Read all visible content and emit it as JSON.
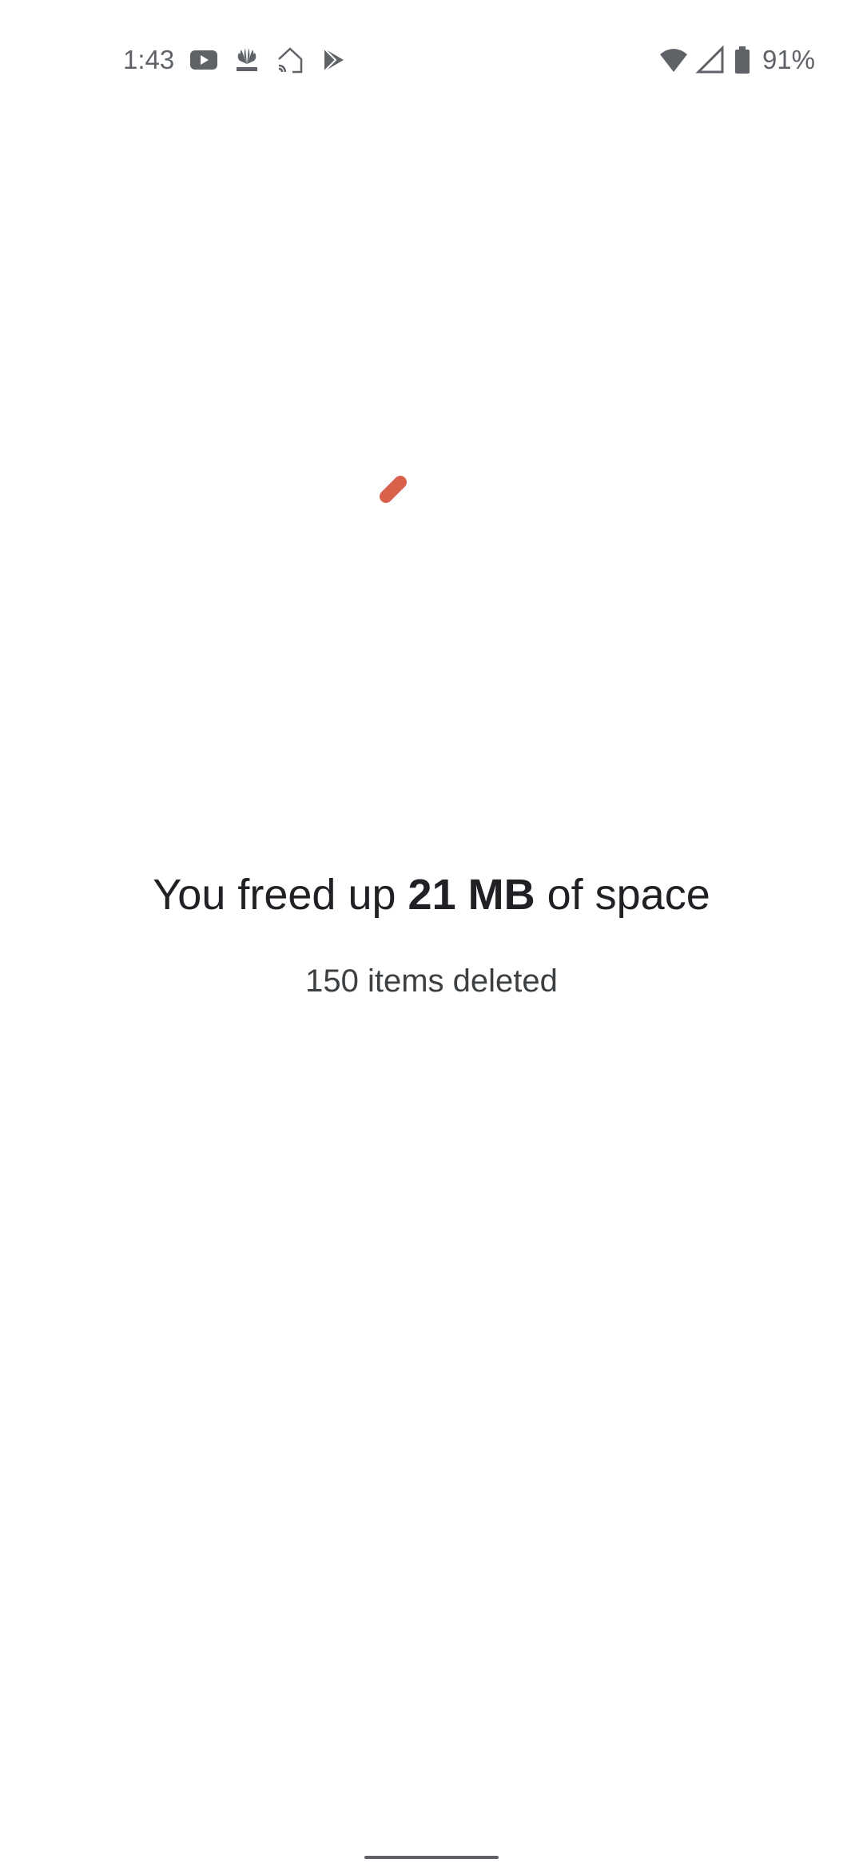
{
  "status_bar": {
    "time": "1:43",
    "battery_percent": "91%",
    "notification_icons": [
      "youtube-icon",
      "cnbc-icon",
      "google-home-icon",
      "play-store-icon"
    ],
    "system_icons": [
      "wifi-icon",
      "cell-signal-icon",
      "battery-icon"
    ]
  },
  "result": {
    "headline_prefix": "You freed up",
    "freed_amount": "21 MB",
    "headline_suffix": "of space",
    "items_deleted": "150 items deleted"
  },
  "colors": {
    "spinner": "#d9604b",
    "text": "#202124",
    "status_text": "#5f6368"
  }
}
